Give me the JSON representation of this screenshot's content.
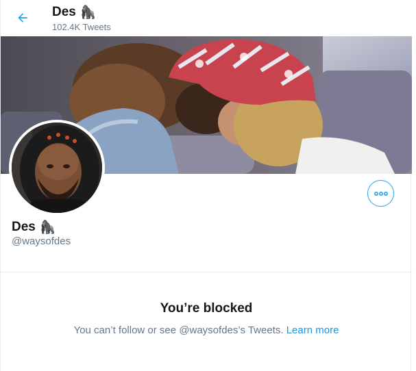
{
  "header": {
    "back_icon": "arrow-left-icon",
    "title": "Des",
    "title_emoji": "🦍",
    "tweet_count": "102.4K Tweets"
  },
  "profile": {
    "display_name": "Des",
    "name_emoji": "🦍",
    "handle": "@waysofdes",
    "more_icon": "more-options-icon"
  },
  "blocked": {
    "title": "You’re blocked",
    "message": "You can’t follow or see @waysofdes’s Tweets.",
    "learn_more": "Learn more"
  },
  "colors": {
    "accent": "#1da1f2",
    "link": "#1b95e0",
    "muted": "#657786",
    "text": "#14171a",
    "border": "#e6ecf0"
  }
}
